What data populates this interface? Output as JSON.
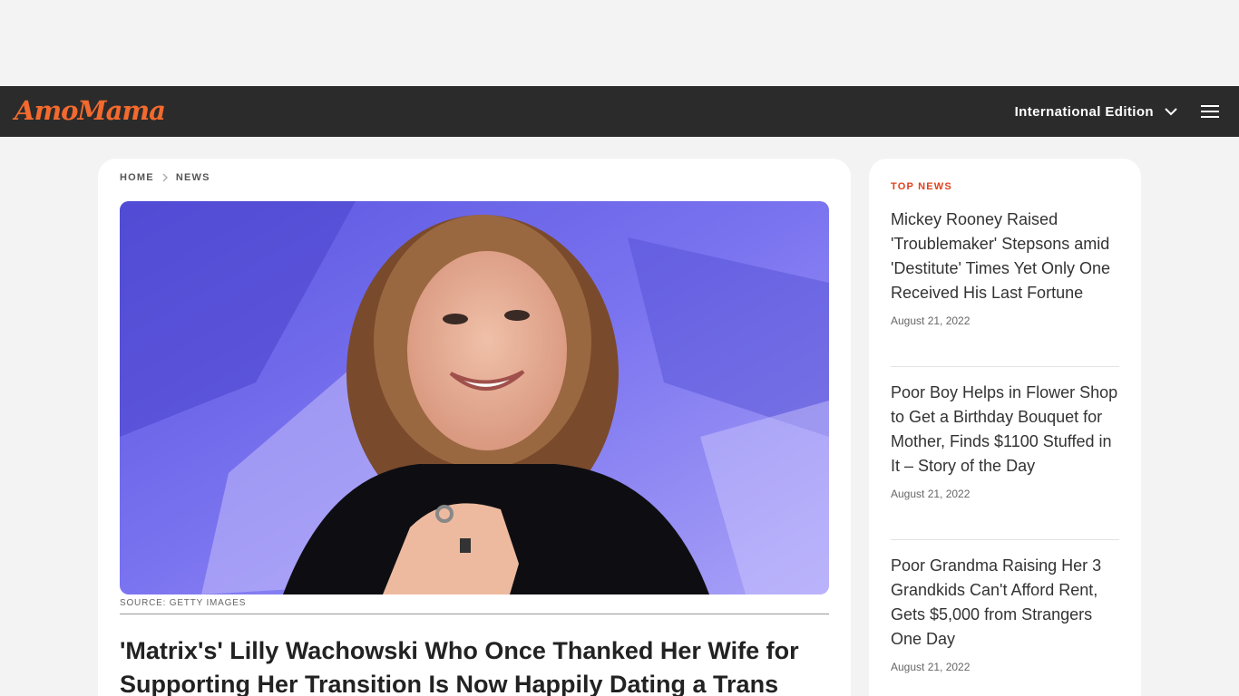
{
  "header": {
    "logo_text": "AmoMama",
    "edition_label": "International Edition"
  },
  "breadcrumb": {
    "home": "HOME",
    "news": "NEWS"
  },
  "article": {
    "image_source": "SOURCE: GETTY IMAGES",
    "headline": "'Matrix's' Lilly Wachowski Who Once Thanked Her Wife for Supporting Her Transition Is Now Happily Dating a Trans"
  },
  "sidebar": {
    "title": "TOP NEWS",
    "items": [
      {
        "title": "Mickey Rooney Raised 'Troublemaker' Stepsons amid 'Destitute' Times Yet Only One Received His Last Fortune",
        "date": "August 21, 2022"
      },
      {
        "title": "Poor Boy Helps in Flower Shop to Get a Birthday Bouquet for Mother, Finds $1100 Stuffed in It – Story of the Day",
        "date": "August 21, 2022"
      },
      {
        "title": "Poor Grandma Raising Her 3 Grandkids Can't Afford Rent, Gets $5,000 from Strangers One Day",
        "date": "August 21, 2022"
      }
    ]
  },
  "colors": {
    "header_bg": "#2b2b2b",
    "brand_orange": "#f26a2e",
    "top_news_red": "#e0401d",
    "page_bg": "#f3f3f3"
  },
  "icons": {
    "edition": "chevron-down-icon",
    "menu": "hamburger-menu-icon",
    "breadcrumb_separator": "chevron-right-icon"
  }
}
